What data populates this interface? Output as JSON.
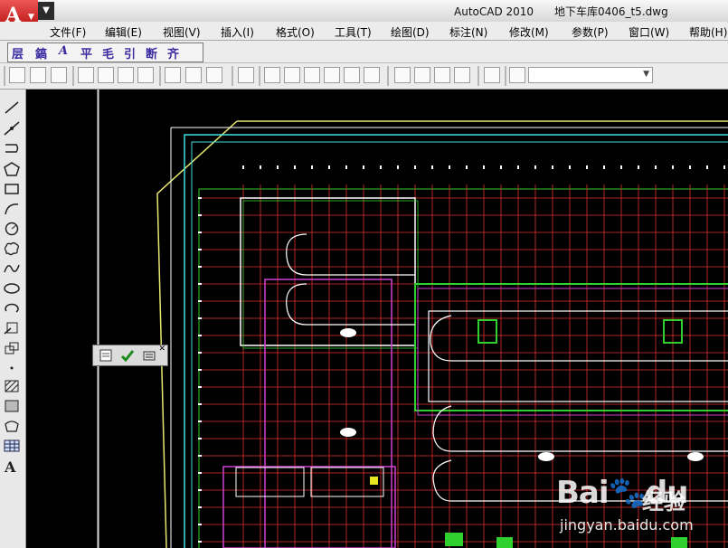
{
  "titlebar": {
    "app_name": "AutoCAD 2010",
    "file_name": "地下车库0406_t5.dwg"
  },
  "menu": [
    "文件(F)",
    "编辑(E)",
    "视图(V)",
    "插入(I)",
    "格式(O)",
    "工具(T)",
    "绘图(D)",
    "标注(N)",
    "修改(M)",
    "参数(P)",
    "窗口(W)",
    "帮助(H)"
  ],
  "tianzheng_toolbar": [
    "层",
    "鎬",
    "A",
    "平",
    "毛",
    "引",
    "断",
    "齐"
  ],
  "view_combo": {
    "value": ""
  },
  "draw_tools": [
    "line-icon",
    "construction-line-icon",
    "polyline-icon",
    "polygon-icon",
    "rectangle-icon",
    "arc-icon",
    "circle-icon",
    "revision-cloud-icon",
    "spline-icon",
    "ellipse-icon",
    "ellipse-arc-icon",
    "insert-block-icon",
    "make-block-icon",
    "point-icon",
    "hatch-icon",
    "gradient-icon",
    "region-icon",
    "table-icon",
    "multiline-text-icon"
  ],
  "multiline_text_glyph": "A",
  "floating_toolbar": [
    "notepad-icon",
    "check-icon",
    "layer-state-icon"
  ],
  "watermark": {
    "logo": "Bai",
    "logo_tail": "du",
    "cn": "经验",
    "url": "jingyan.baidu.com"
  },
  "colors": {
    "background": "#000000",
    "grid_red": "#e03030",
    "wall_green": "#30d030",
    "outline_cyan": "#40e0e0",
    "boundary_yellow": "#e8e870",
    "room_magenta": "#d040d0",
    "wall_white": "#ffffff",
    "app_red": "#c41d1d"
  }
}
